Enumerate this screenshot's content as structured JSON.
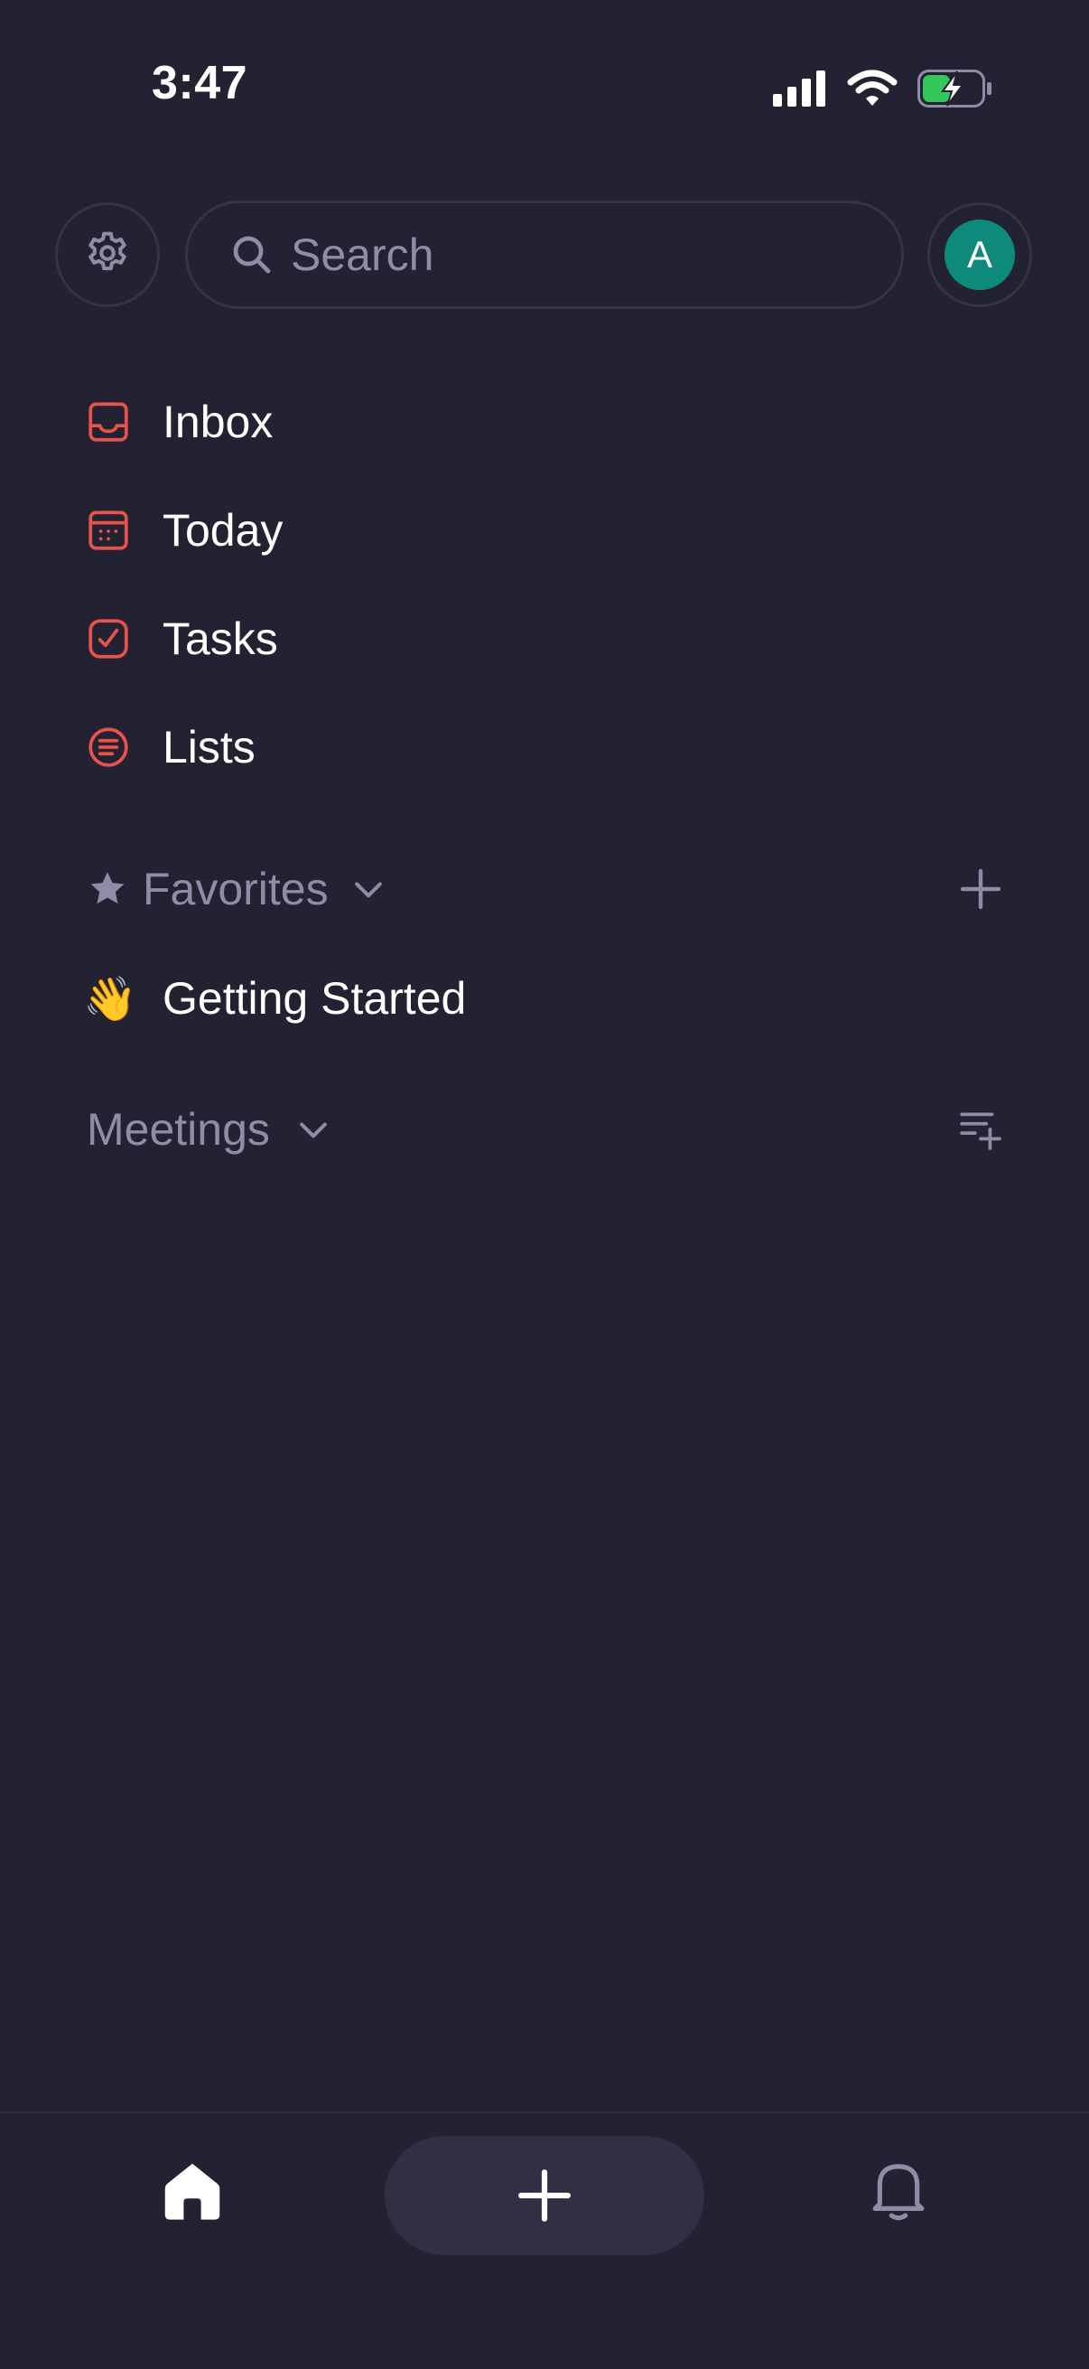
{
  "status_bar": {
    "time": "3:47",
    "icons": [
      "cellular-signal-icon",
      "wifi-icon",
      "battery-charging-icon"
    ]
  },
  "header": {
    "settings_icon": "gear-icon",
    "search": {
      "placeholder": "Search",
      "value": ""
    },
    "avatar_initial": "A",
    "avatar_color": "#0d8a79"
  },
  "nav": {
    "accent_color": "#e5534b",
    "items": [
      {
        "label": "Inbox",
        "icon": "inbox-icon"
      },
      {
        "label": "Today",
        "icon": "calendar-icon"
      },
      {
        "label": "Tasks",
        "icon": "checkbox-icon"
      },
      {
        "label": "Lists",
        "icon": "list-icon"
      }
    ]
  },
  "favorites": {
    "label": "Favorites",
    "icon": "star-icon",
    "action_icon": "plus-icon",
    "items": [
      {
        "emoji": "👋",
        "label": "Getting Started"
      }
    ]
  },
  "meetings": {
    "label": "Meetings",
    "action_icon": "add-to-list-icon"
  },
  "bottom_bar": {
    "tabs": [
      "home-icon",
      "plus-icon",
      "bell-icon"
    ]
  }
}
